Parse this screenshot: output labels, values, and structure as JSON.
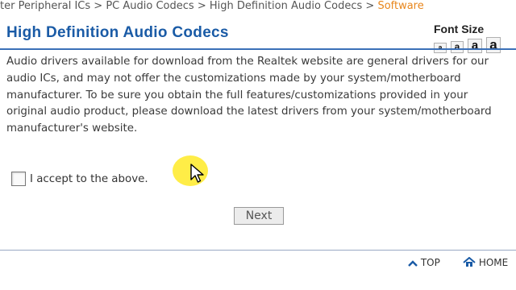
{
  "breadcrumb": {
    "items": [
      "ter Peripheral ICs",
      "PC Audio Codecs",
      "High Definition Audio Codecs"
    ],
    "separator": ">",
    "current": "Software"
  },
  "page": {
    "title": "High Definition Audio Codecs"
  },
  "font_size": {
    "label": "Font Size",
    "options": [
      "a",
      "a",
      "a",
      "a"
    ]
  },
  "notice": {
    "text": "Audio drivers available for download from the Realtek website are general drivers for our audio ICs, and may not offer the customizations made by your system/motherboard manufacturer. To be sure you obtain the full features/customizations provided in your original audio product, please download the latest drivers from your system/motherboard manufacturer's website."
  },
  "accept": {
    "label": "I accept to the above.",
    "checked": false
  },
  "next_button": {
    "label": "Next"
  },
  "footer": {
    "top_label": "TOP",
    "home_label": "HOME"
  },
  "colors": {
    "title": "#1a5ba6",
    "breadcrumb_current": "#e8861c",
    "cursor_highlight": "#ffec3d"
  }
}
